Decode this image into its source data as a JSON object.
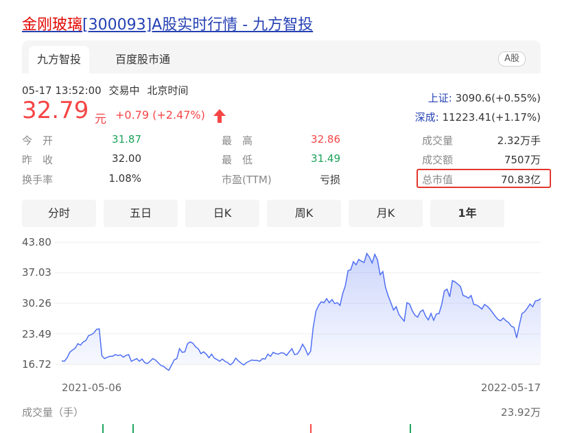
{
  "page_title": {
    "highlight": "金刚玻璃",
    "rest": "[300093]A股实时行情 - 九方智投"
  },
  "tabs": [
    {
      "label": "九方智投",
      "active": true
    },
    {
      "label": "百度股市通",
      "active": false
    }
  ],
  "market_badge": "A股",
  "quote": {
    "time": "05-17 13:52:00",
    "status": "交易中",
    "timezone": "北京时间",
    "price": "32.79",
    "unit": "元",
    "change": "+0.79 (+2.47%)"
  },
  "indices": [
    {
      "name": "上证:",
      "value": "3090.6(+0.55%)"
    },
    {
      "name": "深成:",
      "value": "11223.41(+1.17%)"
    }
  ],
  "stats": {
    "open": {
      "label": "今　开",
      "value": "31.87"
    },
    "prev_close": {
      "label": "昨　收",
      "value": "32.00"
    },
    "turnover": {
      "label": "换手率",
      "value": "1.08%"
    },
    "high": {
      "label": "最　高",
      "value": "32.86"
    },
    "low": {
      "label": "最　低",
      "value": "31.49"
    },
    "pe": {
      "label": "市盈(TTM)",
      "value": "亏损"
    },
    "volume": {
      "label": "成交量",
      "value": "2.32万手"
    },
    "amount": {
      "label": "成交额",
      "value": "7507万"
    },
    "market_cap": {
      "label": "总市值",
      "value": "70.83亿"
    }
  },
  "periods": [
    {
      "label": "分时",
      "active": false
    },
    {
      "label": "五日",
      "active": false
    },
    {
      "label": "日K",
      "active": false
    },
    {
      "label": "周K",
      "active": false
    },
    {
      "label": "月K",
      "active": false
    },
    {
      "label": "1年",
      "active": true
    }
  ],
  "volume_section": {
    "label": "成交量（手）",
    "max": "23.92万"
  },
  "colors": {
    "up": "#f54545",
    "down": "#1ca35b",
    "link": "#2440b3",
    "line": "#4e6ef2",
    "highlight_box": "#e3352b"
  },
  "chart_data": {
    "type": "area",
    "x_start": "2021-05-06",
    "x_end": "2022-05-17",
    "yticks": [
      "43.80",
      "37.03",
      "30.26",
      "23.49",
      "16.72"
    ],
    "ylim": [
      16.72,
      43.8
    ],
    "values": [
      17.5,
      17.4,
      18.2,
      19.4,
      19.9,
      20.3,
      21.3,
      21.0,
      21.7,
      22.0,
      23.1,
      23.3,
      23.7,
      24.5,
      24.6,
      18.6,
      18.0,
      18.3,
      18.5,
      18.5,
      18.9,
      18.7,
      18.8,
      18.3,
      18.7,
      18.9,
      17.4,
      17.7,
      18.0,
      17.4,
      17.9,
      17.1,
      16.9,
      17.4,
      18.0,
      17.7,
      17.1,
      16.5,
      16.3,
      15.8,
      15.4,
      16.5,
      17.7,
      18.0,
      20.2,
      19.4,
      19.5,
      21.3,
      21.7,
      21.4,
      20.6,
      20.2,
      19.1,
      19.5,
      19.0,
      18.2,
      19.0,
      18.1,
      17.8,
      17.4,
      17.9,
      17.4,
      17.1,
      16.6,
      17.1,
      18.1,
      17.5,
      17.0,
      16.6,
      17.1,
      17.4,
      17.7,
      17.6,
      17.6,
      17.4,
      18.0,
      17.9,
      19.0,
      18.5,
      19.4,
      19.1,
      19.0,
      19.3,
      19.2,
      18.7,
      19.5,
      20.2,
      18.9,
      19.0,
      19.9,
      21.2,
      20.2,
      18.8,
      19.6,
      25.0,
      28.5,
      29.8,
      30.6,
      30.4,
      31.3,
      30.4,
      31.1,
      30.2,
      30.4,
      29.8,
      32.4,
      34.2,
      37.5,
      37.7,
      39.5,
      38.8,
      40.0,
      39.6,
      39.3,
      41.3,
      40.5,
      39.2,
      41.1,
      39.9,
      36.6,
      37.3,
      33.8,
      31.9,
      30.4,
      28.8,
      29.5,
      27.8,
      27.0,
      26.3,
      30.4,
      30.1,
      28.6,
      27.6,
      27.2,
      28.4,
      28.8,
      27.4,
      26.6,
      28.0,
      26.5,
      27.9,
      28.0,
      30.0,
      33.0,
      33.4,
      31.7,
      35.3,
      35.0,
      34.5,
      34.0,
      32.0,
      31.8,
      31.4,
      32.0,
      30.0,
      29.9,
      29.5,
      29.0,
      30.0,
      29.6,
      29.0,
      28.2,
      27.4,
      26.7,
      26.4,
      27.0,
      26.4,
      26.0,
      25.2,
      24.9,
      22.6,
      25.4,
      28.0,
      28.4,
      29.2,
      30.1,
      29.5,
      30.8,
      30.9,
      31.3
    ]
  }
}
